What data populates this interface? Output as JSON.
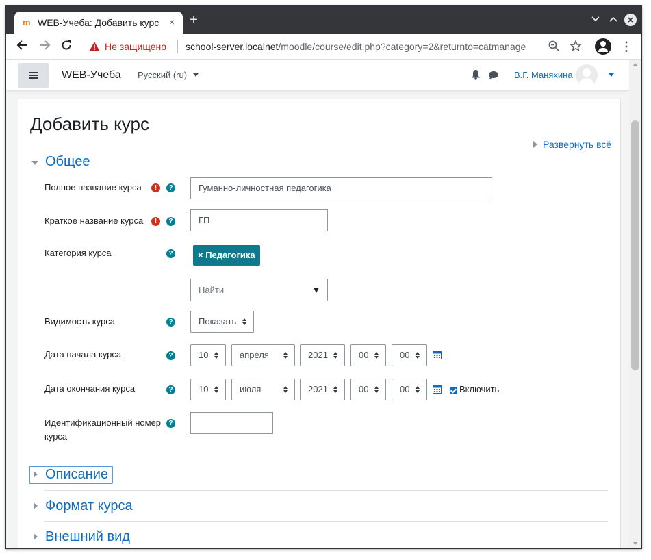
{
  "browser": {
    "tab_title": "WEB-Учеба: Добавить курс",
    "tab_close": "×",
    "new_tab": "+",
    "security_label": "Не защищено",
    "url_host": "school-server.localnet",
    "url_path": "/moodle/course/edit.php?category=2&returnto=catmanage"
  },
  "navbar": {
    "brand": "WEB-Учеба",
    "language": "Русский ‎(ru)‎",
    "user_name": "В.Г. Маняхина"
  },
  "page": {
    "title": "Добавить курс",
    "expand_all": "Развернуть всё"
  },
  "sections": {
    "general": "Общее",
    "description": "Описание",
    "format": "Формат курса",
    "appearance": "Внешний вид"
  },
  "form": {
    "fullname_label": "Полное название курса",
    "fullname_value": "Гуманно-личностная педагогика",
    "shortname_label": "Краткое название курса",
    "shortname_value": "ГП",
    "category_label": "Категория курса",
    "category_chip": "× Педагогика",
    "category_search_placeholder": "Найти",
    "visibility_label": "Видимость курса",
    "visibility_value": "Показать",
    "start_date_label": "Дата начала курса",
    "start_date": {
      "day": "10",
      "month": "апреля",
      "year": "2021",
      "hour": "00",
      "minute": "00"
    },
    "end_date_label": "Дата окончания курса",
    "end_date": {
      "day": "10",
      "month": "июля",
      "year": "2021",
      "hour": "00",
      "minute": "00"
    },
    "end_date_enable_label": "Включить",
    "idnumber_label_line1": "Идентификационный номер",
    "idnumber_label_line2": "курса",
    "idnumber_value": ""
  },
  "colors": {
    "link": "#0f6cbf",
    "required": "#ca3120",
    "help": "#008196",
    "chip": "#0f7a8d"
  }
}
